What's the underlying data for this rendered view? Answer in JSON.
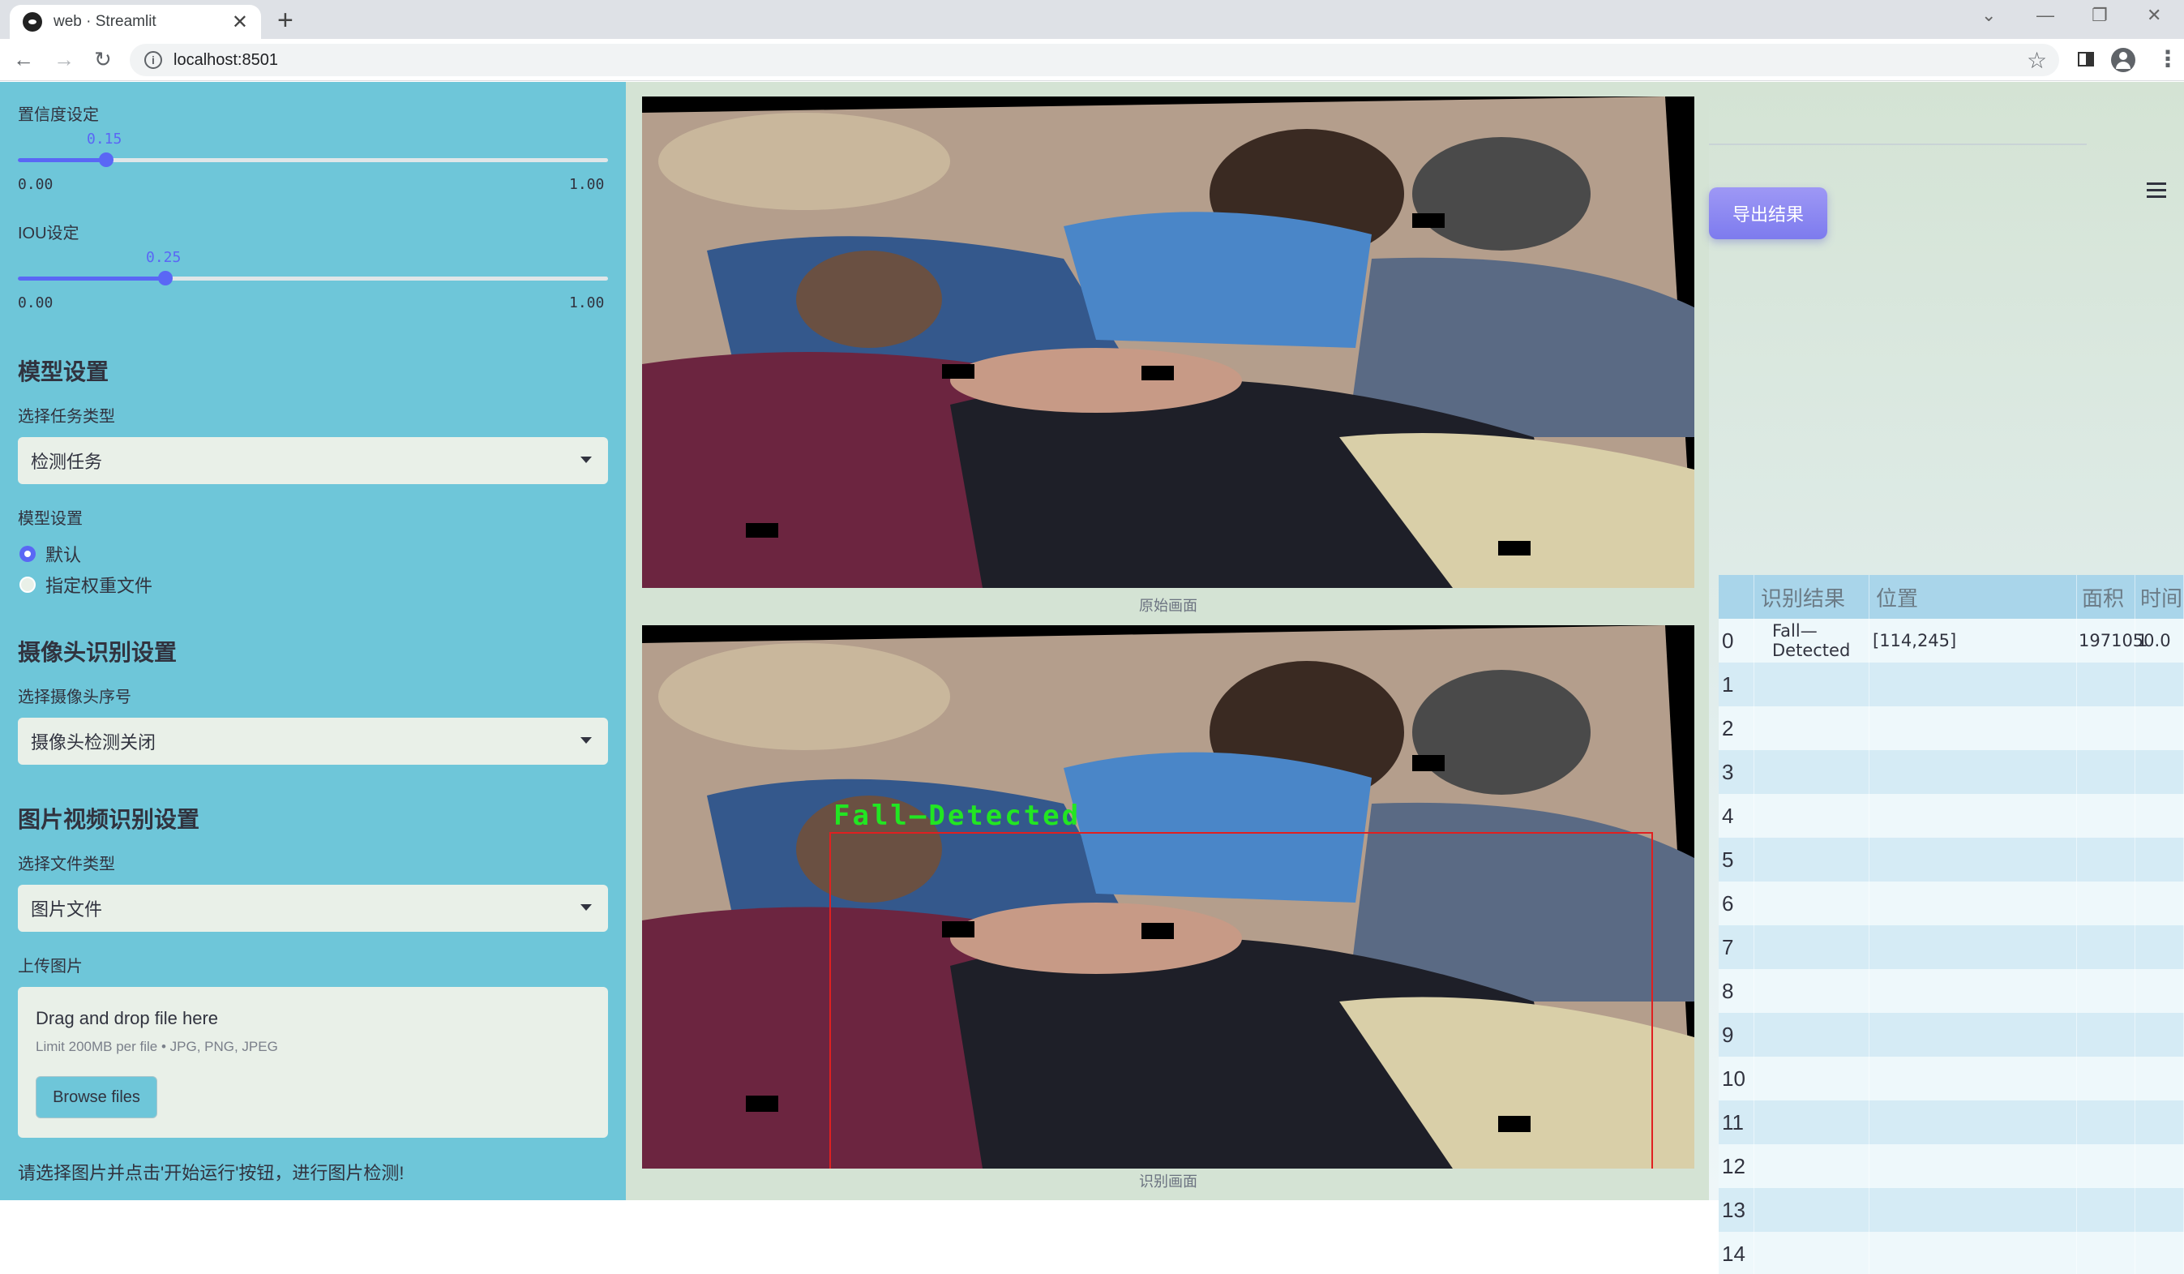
{
  "browser": {
    "tab_title": "web · Streamlit",
    "url": "localhost:8501"
  },
  "sidebar": {
    "confidence": {
      "label": "置信度设定",
      "value": "0.15",
      "value_fraction": 0.15,
      "min": "0.00",
      "max": "1.00"
    },
    "iou": {
      "label": "IOU设定",
      "value": "0.25",
      "value_fraction": 0.25,
      "min": "0.00",
      "max": "1.00"
    },
    "model_heading": "模型设置",
    "task_label": "选择任务类型",
    "task_value": "检测任务",
    "model_label": "模型设置",
    "model_options": [
      "默认",
      "指定权重文件"
    ],
    "model_selected": "默认",
    "camera_heading": "摄像头识别设置",
    "camera_label": "选择摄像头序号",
    "camera_value": "摄像头检测关闭",
    "media_heading": "图片视频识别设置",
    "filetype_label": "选择文件类型",
    "filetype_value": "图片文件",
    "upload_label": "上传图片",
    "upload_title": "Drag and drop file here",
    "upload_limit": "Limit 200MB per file • JPG, PNG, JPEG",
    "browse_label": "Browse files",
    "hint": "请选择图片并点击'开始运行'按钮，进行图片检测!"
  },
  "main": {
    "original_caption": "原始画面",
    "result_caption": "识别画面",
    "detection_label": "Fall—Detected",
    "export_label": "导出结果"
  },
  "table": {
    "headers": [
      "",
      "识别结果",
      "位置",
      "面积",
      "时间"
    ],
    "rows": [
      {
        "index": "0",
        "result": "Fall—Detected",
        "position": "[114,245]",
        "area": "1971050.0",
        "time": "1"
      },
      {
        "index": "1",
        "result": "",
        "position": "",
        "area": "",
        "time": ""
      },
      {
        "index": "2",
        "result": "",
        "position": "",
        "area": "",
        "time": ""
      },
      {
        "index": "3",
        "result": "",
        "position": "",
        "area": "",
        "time": ""
      },
      {
        "index": "4",
        "result": "",
        "position": "",
        "area": "",
        "time": ""
      },
      {
        "index": "5",
        "result": "",
        "position": "",
        "area": "",
        "time": ""
      },
      {
        "index": "6",
        "result": "",
        "position": "",
        "area": "",
        "time": ""
      },
      {
        "index": "7",
        "result": "",
        "position": "",
        "area": "",
        "time": ""
      },
      {
        "index": "8",
        "result": "",
        "position": "",
        "area": "",
        "time": ""
      },
      {
        "index": "9",
        "result": "",
        "position": "",
        "area": "",
        "time": ""
      },
      {
        "index": "10",
        "result": "",
        "position": "",
        "area": "",
        "time": ""
      },
      {
        "index": "11",
        "result": "",
        "position": "",
        "area": "",
        "time": ""
      },
      {
        "index": "12",
        "result": "",
        "position": "",
        "area": "",
        "time": ""
      },
      {
        "index": "13",
        "result": "",
        "position": "",
        "area": "",
        "time": ""
      },
      {
        "index": "14",
        "result": "",
        "position": "",
        "area": "",
        "time": ""
      }
    ]
  },
  "colors": {
    "sidebar_bg": "#6ec6d9",
    "main_bg": "#d4e3d4",
    "slider_accent": "#5a67f5",
    "detection_box": "#e02020",
    "detection_text": "#22e622",
    "export_button": "#8b88f2"
  }
}
